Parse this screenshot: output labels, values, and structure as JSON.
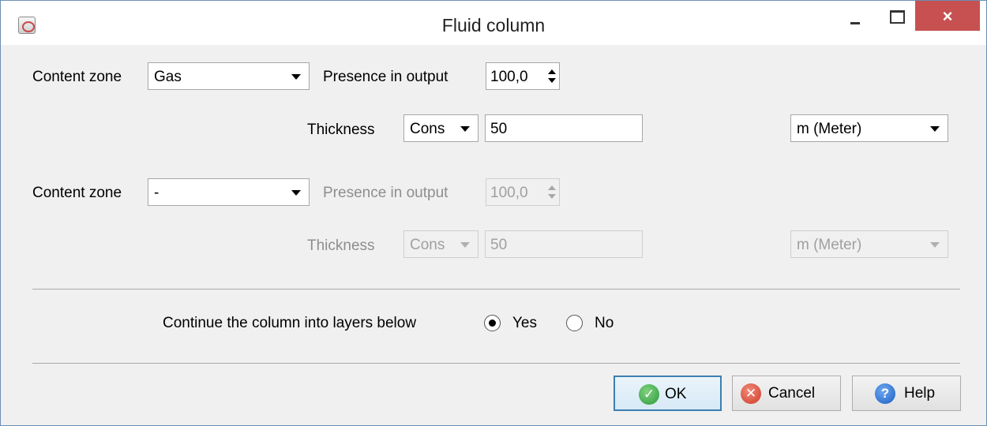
{
  "window": {
    "title": "Fluid column",
    "close_glyph": "×"
  },
  "zone1": {
    "label": "Content zone",
    "selected": "Gas",
    "presence_label": "Presence in output",
    "presence_value": "100,0",
    "thickness_label": "Thickness",
    "thickness_mode": "Cons",
    "thickness_value": "50",
    "unit": "m (Meter)"
  },
  "zone2": {
    "label": "Content zone",
    "selected": "-",
    "presence_label": "Presence in output",
    "presence_value": "100,0",
    "thickness_label": "Thickness",
    "thickness_mode": "Cons",
    "thickness_value": "50",
    "unit": "m (Meter)"
  },
  "continue": {
    "label": "Continue the column into layers below",
    "yes_label": "Yes",
    "no_label": "No",
    "selected": "Yes"
  },
  "buttons": {
    "ok": "OK",
    "cancel": "Cancel",
    "help": "Help",
    "ok_icon": "✓",
    "cancel_icon": "✕",
    "help_icon": "?"
  },
  "icons": {
    "ok": "check-circle-icon",
    "cancel": "x-circle-icon",
    "help": "question-circle-icon"
  }
}
